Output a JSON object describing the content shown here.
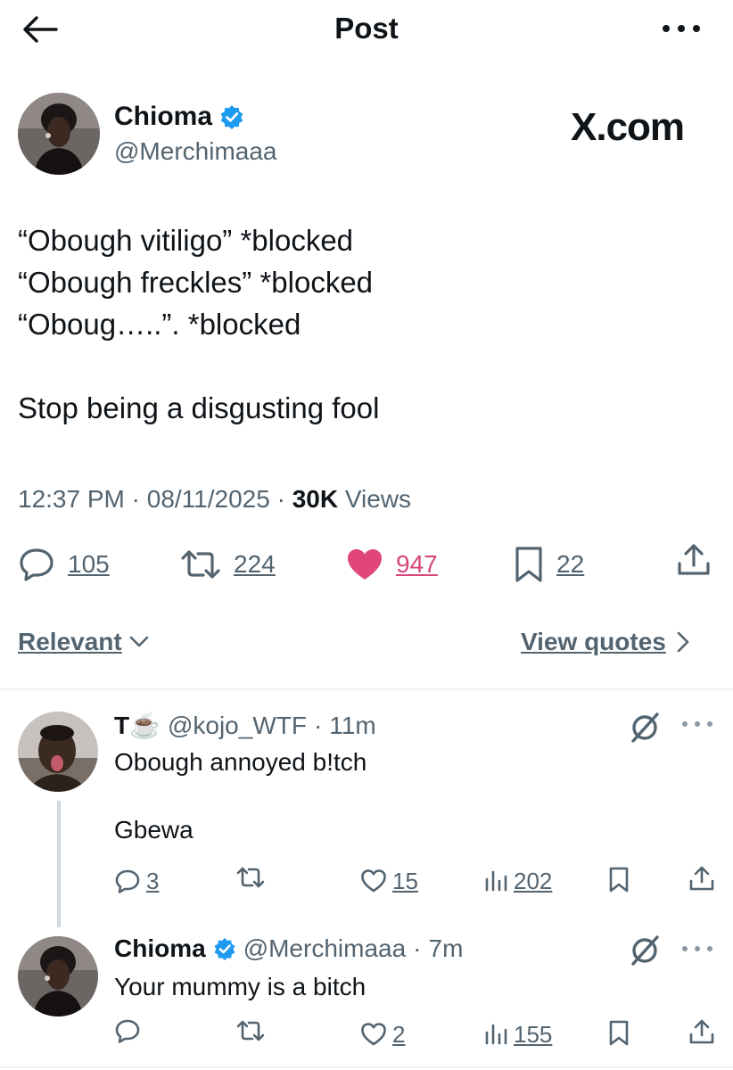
{
  "header": {
    "title": "Post",
    "back_icon": "arrow-left-icon",
    "more_icon": "more-horizontal-icon"
  },
  "author": {
    "name": "Chioma",
    "handle": "@Merchimaaa",
    "verified": true,
    "verified_color": "#1d9bf0"
  },
  "brand": {
    "label": "X.com"
  },
  "post": {
    "lines": [
      "“Obough vitiligo” *blocked",
      "“Obough freckles” *blocked",
      "“Oboug…..”. *blocked",
      "",
      "Stop being a disgusting fool"
    ],
    "time": "12:37 PM",
    "date": "08/11/2025",
    "views_count": "30K",
    "views_label": "Views"
  },
  "actions": {
    "replies": "105",
    "reposts": "224",
    "likes": "947",
    "bookmarks": "22",
    "like_color": "#e0457b"
  },
  "sort": {
    "label": "Relevant",
    "view_quotes": "View quotes"
  },
  "replies": [
    {
      "name": "T☕️",
      "handle": "@kojo_WTF",
      "time": "11m",
      "lines": [
        "Obough annoyed b!tch",
        "",
        "Gbewa"
      ],
      "counts": {
        "replies": "3",
        "reposts": "",
        "likes": "15",
        "views": "202"
      }
    },
    {
      "name": "Chioma",
      "handle": "@Merchimaaa",
      "time": "7m",
      "verified": true,
      "lines": [
        "Your mummy is a bitch"
      ],
      "counts": {
        "replies": "",
        "reposts": "",
        "likes": "2",
        "views": "155"
      }
    }
  ],
  "colors": {
    "text": "#0f1419",
    "secondary": "#536471",
    "divider": "#eff3f4"
  }
}
